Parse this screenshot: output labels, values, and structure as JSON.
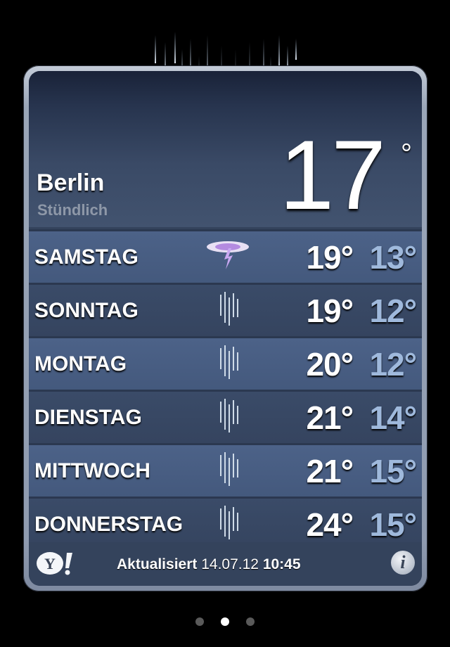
{
  "location": {
    "city": "Berlin",
    "subtitle": "Stündlich"
  },
  "current": {
    "temperature": "17",
    "degree_symbol": "°",
    "condition_icon": "heavy-rain-icon"
  },
  "forecast": [
    {
      "day": "SAMSTAG",
      "icon": "thunderstorm-icon",
      "high": "19°",
      "low": "13°"
    },
    {
      "day": "SONNTAG",
      "icon": "rain-icon",
      "high": "19°",
      "low": "12°"
    },
    {
      "day": "MONTAG",
      "icon": "rain-icon",
      "high": "20°",
      "low": "12°"
    },
    {
      "day": "DIENSTAG",
      "icon": "rain-icon",
      "high": "21°",
      "low": "14°"
    },
    {
      "day": "MITTWOCH",
      "icon": "rain-icon",
      "high": "21°",
      "low": "15°"
    },
    {
      "day": "DONNERSTAG",
      "icon": "rain-icon",
      "high": "24°",
      "low": "15°"
    }
  ],
  "footer": {
    "provider_logo": "yahoo-logo",
    "provider_letters": "Y!",
    "updated_label": "Aktualisiert",
    "updated_date": "14.07.12",
    "updated_time": "10:45",
    "info_letter": "i"
  },
  "pager": {
    "page_count": 3,
    "active_page": 2
  },
  "colors": {
    "low_temp": "#9fb9dc",
    "row_light": "#4c6288",
    "row_dark": "#3a4b68",
    "background": "#000000"
  }
}
